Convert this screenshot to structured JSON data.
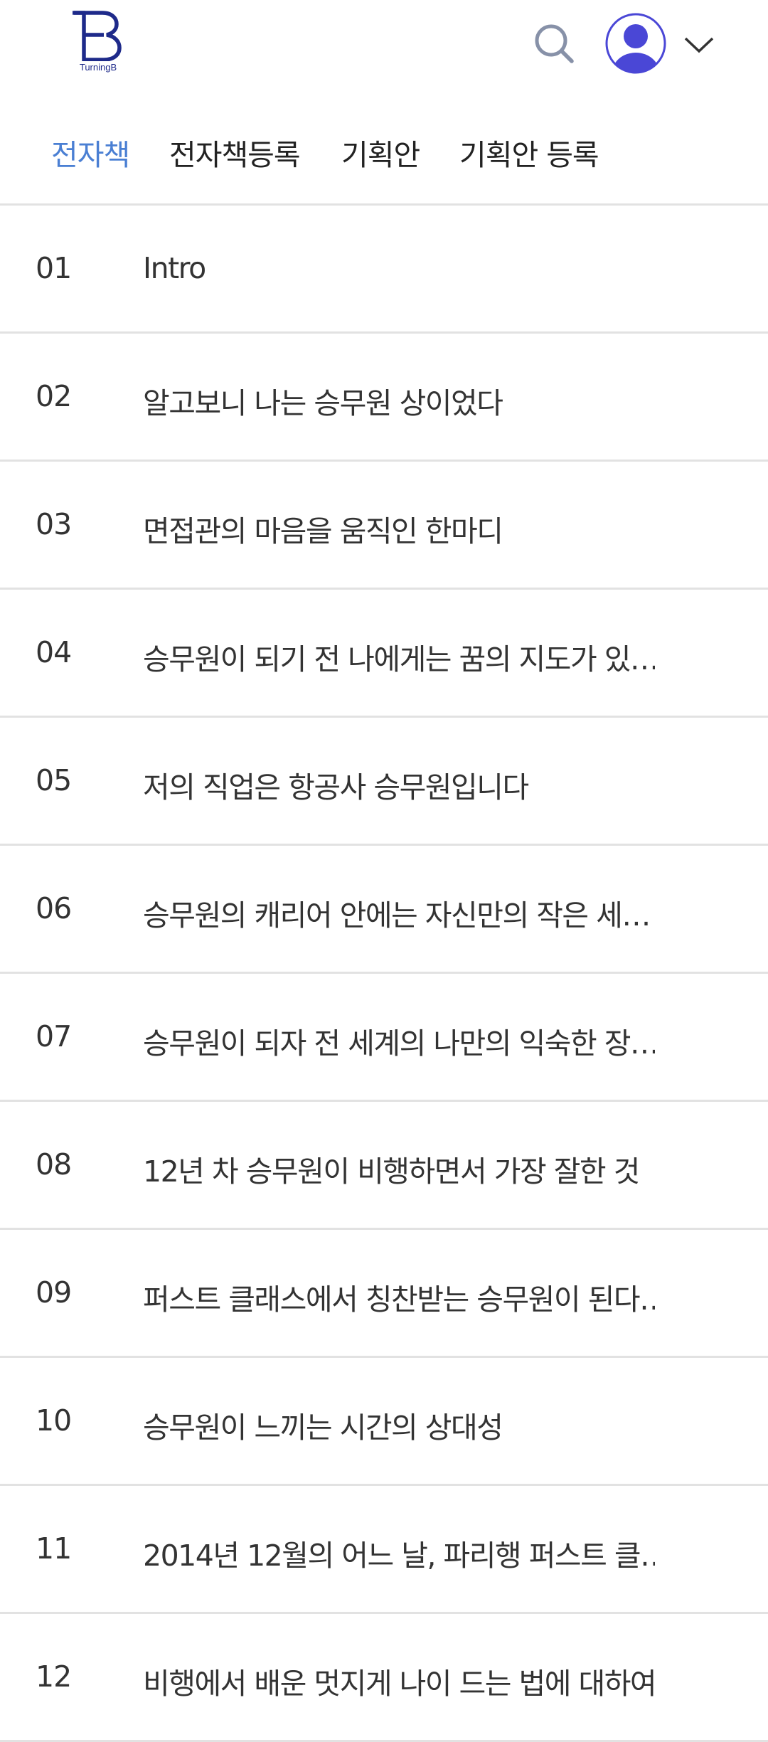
{
  "brand": {
    "logo_letter": "B",
    "name": "TurningB",
    "color": "#1e2a8a"
  },
  "header": {
    "search_icon": "search-icon",
    "avatar_icon": "user-avatar-icon",
    "avatar_color": "#4a47d6",
    "menu_icon": "chevron-down-icon"
  },
  "tabs": [
    {
      "label": "전자책",
      "active": true
    },
    {
      "label": "전자책등록",
      "active": false
    },
    {
      "label": "기획안",
      "active": false
    },
    {
      "label": "기획안 등록",
      "active": false
    }
  ],
  "colors": {
    "active_tab": "#4a7fd3",
    "divider": "#e2e2e2",
    "text": "#333333"
  },
  "chapters": [
    {
      "num": "01",
      "title": "Intro"
    },
    {
      "num": "02",
      "title": "알고보니 나는 승무원 상이었다"
    },
    {
      "num": "03",
      "title": "면접관의 마음을 움직인 한마디"
    },
    {
      "num": "04",
      "title": "승무원이 되기 전 나에게는 꿈의 지도가 있…"
    },
    {
      "num": "05",
      "title": "저의 직업은 항공사 승무원입니다"
    },
    {
      "num": "06",
      "title": "승무원의 캐리어 안에는 자신만의 작은 세…"
    },
    {
      "num": "07",
      "title": "승무원이 되자 전 세계의 나만의 익숙한 장…"
    },
    {
      "num": "08",
      "title": "12년 차 승무원이 비행하면서 가장 잘한 것"
    },
    {
      "num": "09",
      "title": "퍼스트 클래스에서 칭찬받는 승무원이 된다…"
    },
    {
      "num": "10",
      "title": "승무원이 느끼는 시간의 상대성"
    },
    {
      "num": "11",
      "title": "2014년 12월의 어느 날, 파리행 퍼스트 클…"
    },
    {
      "num": "12",
      "title": "비행에서 배운 멋지게 나이 드는 법에 대하여"
    }
  ]
}
